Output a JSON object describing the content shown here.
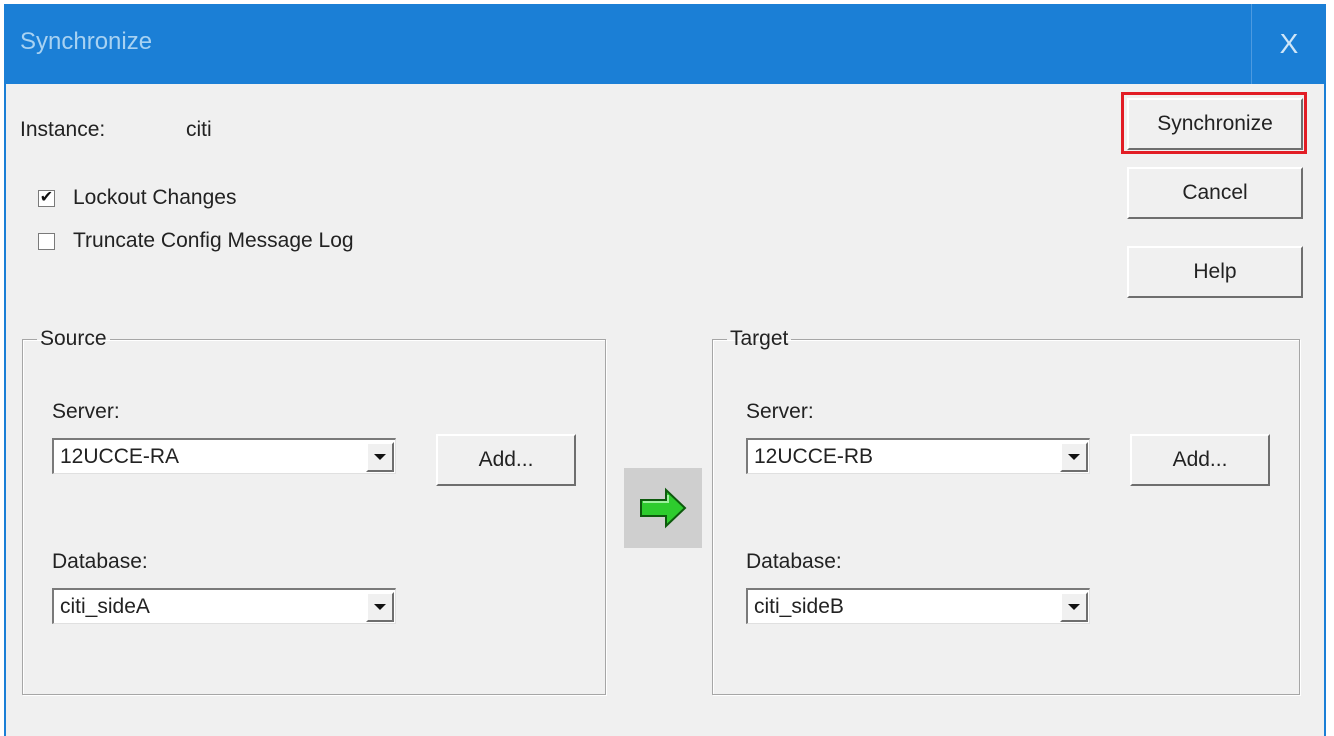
{
  "window": {
    "title": "Synchronize",
    "close_label": "X"
  },
  "instance": {
    "label": "Instance:",
    "value": "citi"
  },
  "options": {
    "lockout": {
      "label": "Lockout Changes",
      "checked": true,
      "mark": "✔"
    },
    "truncate": {
      "label": "Truncate Config Message Log",
      "checked": false,
      "mark": ""
    }
  },
  "buttons": {
    "synchronize": "Synchronize",
    "cancel": "Cancel",
    "help": "Help"
  },
  "source": {
    "legend": "Source",
    "server_label": "Server:",
    "server_value": "12UCCE-RA",
    "add_label": "Add...",
    "database_label": "Database:",
    "database_value": "citi_sideA"
  },
  "target": {
    "legend": "Target",
    "server_label": "Server:",
    "server_value": "12UCCE-RB",
    "add_label": "Add...",
    "database_label": "Database:",
    "database_value": "citi_sideB"
  },
  "icons": {
    "close": "close-icon",
    "transfer": "green-arrow-right-icon",
    "dropdown": "chevron-down-icon",
    "check": "check-icon"
  },
  "colors": {
    "titlebar": "#1b7fd6",
    "highlight": "#e21d25",
    "arrow": "#2ecc2e"
  }
}
